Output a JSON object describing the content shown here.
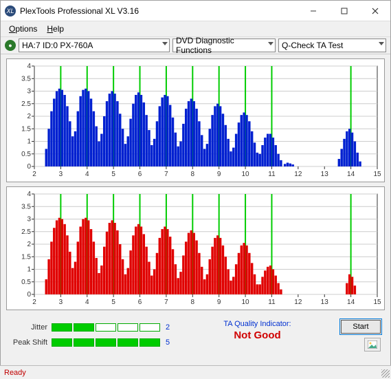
{
  "window": {
    "title": "PlexTools Professional XL V3.16"
  },
  "menu": {
    "options": "Options",
    "help": "Help"
  },
  "toolbar": {
    "drive": "HA:7 ID:0   PX-760A",
    "func": "DVD Diagnostic Functions",
    "test": "Q-Check TA Test"
  },
  "meters": {
    "jitter_label": "Jitter",
    "jitter_filled": 2,
    "jitter_value": "2",
    "peak_label": "Peak Shift",
    "peak_filled": 5,
    "peak_value": "5"
  },
  "quality": {
    "label": "TA Quality Indicator:",
    "value": "Not Good"
  },
  "buttons": {
    "start": "Start"
  },
  "status": "Ready",
  "chart_data": [
    {
      "type": "bar",
      "color": "#0020d0",
      "xlim": [
        2,
        15
      ],
      "ylim": [
        0,
        4
      ],
      "yticks": [
        0,
        0.5,
        1,
        1.5,
        2,
        2.5,
        3,
        3.5,
        4
      ],
      "xticks": [
        2,
        3,
        4,
        5,
        6,
        7,
        8,
        9,
        10,
        11,
        12,
        13,
        14,
        15
      ],
      "markers": [
        3,
        4,
        5,
        6,
        7,
        8,
        9,
        10,
        11,
        14
      ],
      "series": [
        {
          "x": 2.45,
          "y": 0.7
        },
        {
          "x": 2.55,
          "y": 1.5
        },
        {
          "x": 2.65,
          "y": 2.2
        },
        {
          "x": 2.75,
          "y": 2.7
        },
        {
          "x": 2.85,
          "y": 3.0
        },
        {
          "x": 2.95,
          "y": 3.1
        },
        {
          "x": 3.05,
          "y": 3.05
        },
        {
          "x": 3.15,
          "y": 2.85
        },
        {
          "x": 3.25,
          "y": 2.4
        },
        {
          "x": 3.35,
          "y": 1.8
        },
        {
          "x": 3.45,
          "y": 1.2
        },
        {
          "x": 3.55,
          "y": 1.4
        },
        {
          "x": 3.65,
          "y": 2.2
        },
        {
          "x": 3.75,
          "y": 2.8
        },
        {
          "x": 3.85,
          "y": 3.05
        },
        {
          "x": 3.95,
          "y": 3.1
        },
        {
          "x": 4.05,
          "y": 3.0
        },
        {
          "x": 4.15,
          "y": 2.7
        },
        {
          "x": 4.25,
          "y": 2.2
        },
        {
          "x": 4.35,
          "y": 1.6
        },
        {
          "x": 4.45,
          "y": 1.0
        },
        {
          "x": 4.55,
          "y": 1.3
        },
        {
          "x": 4.65,
          "y": 2.0
        },
        {
          "x": 4.75,
          "y": 2.6
        },
        {
          "x": 4.85,
          "y": 2.9
        },
        {
          "x": 4.95,
          "y": 3.0
        },
        {
          "x": 5.05,
          "y": 2.9
        },
        {
          "x": 5.15,
          "y": 2.6
        },
        {
          "x": 5.25,
          "y": 2.1
        },
        {
          "x": 5.35,
          "y": 1.5
        },
        {
          "x": 5.45,
          "y": 0.9
        },
        {
          "x": 5.55,
          "y": 1.2
        },
        {
          "x": 5.65,
          "y": 1.9
        },
        {
          "x": 5.75,
          "y": 2.5
        },
        {
          "x": 5.85,
          "y": 2.85
        },
        {
          "x": 5.95,
          "y": 2.95
        },
        {
          "x": 6.05,
          "y": 2.85
        },
        {
          "x": 6.15,
          "y": 2.55
        },
        {
          "x": 6.25,
          "y": 2.05
        },
        {
          "x": 6.35,
          "y": 1.45
        },
        {
          "x": 6.45,
          "y": 0.85
        },
        {
          "x": 6.55,
          "y": 1.1
        },
        {
          "x": 6.65,
          "y": 1.8
        },
        {
          "x": 6.75,
          "y": 2.4
        },
        {
          "x": 6.85,
          "y": 2.75
        },
        {
          "x": 6.95,
          "y": 2.85
        },
        {
          "x": 7.05,
          "y": 2.8
        },
        {
          "x": 7.15,
          "y": 2.45
        },
        {
          "x": 7.25,
          "y": 1.95
        },
        {
          "x": 7.35,
          "y": 1.35
        },
        {
          "x": 7.45,
          "y": 0.8
        },
        {
          "x": 7.55,
          "y": 1.0
        },
        {
          "x": 7.65,
          "y": 1.7
        },
        {
          "x": 7.75,
          "y": 2.3
        },
        {
          "x": 7.85,
          "y": 2.6
        },
        {
          "x": 7.95,
          "y": 2.7
        },
        {
          "x": 8.05,
          "y": 2.6
        },
        {
          "x": 8.15,
          "y": 2.3
        },
        {
          "x": 8.25,
          "y": 1.8
        },
        {
          "x": 8.35,
          "y": 1.25
        },
        {
          "x": 8.45,
          "y": 0.7
        },
        {
          "x": 8.55,
          "y": 0.9
        },
        {
          "x": 8.65,
          "y": 1.5
        },
        {
          "x": 8.75,
          "y": 2.05
        },
        {
          "x": 8.85,
          "y": 2.4
        },
        {
          "x": 8.95,
          "y": 2.5
        },
        {
          "x": 9.05,
          "y": 2.4
        },
        {
          "x": 9.15,
          "y": 2.1
        },
        {
          "x": 9.25,
          "y": 1.65
        },
        {
          "x": 9.35,
          "y": 1.1
        },
        {
          "x": 9.45,
          "y": 0.6
        },
        {
          "x": 9.55,
          "y": 0.75
        },
        {
          "x": 9.65,
          "y": 1.3
        },
        {
          "x": 9.75,
          "y": 1.75
        },
        {
          "x": 9.85,
          "y": 2.05
        },
        {
          "x": 9.95,
          "y": 2.15
        },
        {
          "x": 10.05,
          "y": 2.05
        },
        {
          "x": 10.15,
          "y": 1.8
        },
        {
          "x": 10.25,
          "y": 1.4
        },
        {
          "x": 10.35,
          "y": 0.95
        },
        {
          "x": 10.45,
          "y": 0.55
        },
        {
          "x": 10.55,
          "y": 0.5
        },
        {
          "x": 10.65,
          "y": 0.85
        },
        {
          "x": 10.75,
          "y": 1.15
        },
        {
          "x": 10.85,
          "y": 1.3
        },
        {
          "x": 10.95,
          "y": 1.3
        },
        {
          "x": 11.05,
          "y": 1.15
        },
        {
          "x": 11.15,
          "y": 0.85
        },
        {
          "x": 11.25,
          "y": 0.5
        },
        {
          "x": 11.35,
          "y": 0.25
        },
        {
          "x": 11.5,
          "y": 0.1
        },
        {
          "x": 11.6,
          "y": 0.15
        },
        {
          "x": 11.7,
          "y": 0.12
        },
        {
          "x": 11.8,
          "y": 0.08
        },
        {
          "x": 13.55,
          "y": 0.3
        },
        {
          "x": 13.65,
          "y": 0.7
        },
        {
          "x": 13.75,
          "y": 1.1
        },
        {
          "x": 13.85,
          "y": 1.4
        },
        {
          "x": 13.95,
          "y": 1.5
        },
        {
          "x": 14.05,
          "y": 1.35
        },
        {
          "x": 14.15,
          "y": 1.0
        },
        {
          "x": 14.25,
          "y": 0.55
        },
        {
          "x": 14.35,
          "y": 0.2
        }
      ]
    },
    {
      "type": "bar",
      "color": "#e00000",
      "xlim": [
        2,
        15
      ],
      "ylim": [
        0,
        4
      ],
      "yticks": [
        0,
        0.5,
        1,
        1.5,
        2,
        2.5,
        3,
        3.5,
        4
      ],
      "xticks": [
        2,
        3,
        4,
        5,
        6,
        7,
        8,
        9,
        10,
        11,
        12,
        13,
        14,
        15
      ],
      "markers": [
        3,
        4,
        5,
        6,
        7,
        8,
        9,
        10,
        11,
        14
      ],
      "series": [
        {
          "x": 2.45,
          "y": 0.6
        },
        {
          "x": 2.55,
          "y": 1.4
        },
        {
          "x": 2.65,
          "y": 2.1
        },
        {
          "x": 2.75,
          "y": 2.65
        },
        {
          "x": 2.85,
          "y": 2.95
        },
        {
          "x": 2.95,
          "y": 3.05
        },
        {
          "x": 3.05,
          "y": 3.0
        },
        {
          "x": 3.15,
          "y": 2.8
        },
        {
          "x": 3.25,
          "y": 2.35
        },
        {
          "x": 3.35,
          "y": 1.7
        },
        {
          "x": 3.45,
          "y": 1.05
        },
        {
          "x": 3.55,
          "y": 1.3
        },
        {
          "x": 3.65,
          "y": 2.1
        },
        {
          "x": 3.75,
          "y": 2.7
        },
        {
          "x": 3.85,
          "y": 3.0
        },
        {
          "x": 3.95,
          "y": 3.05
        },
        {
          "x": 4.05,
          "y": 2.95
        },
        {
          "x": 4.15,
          "y": 2.6
        },
        {
          "x": 4.25,
          "y": 2.1
        },
        {
          "x": 4.35,
          "y": 1.45
        },
        {
          "x": 4.45,
          "y": 0.85
        },
        {
          "x": 4.55,
          "y": 1.15
        },
        {
          "x": 4.65,
          "y": 1.9
        },
        {
          "x": 4.75,
          "y": 2.5
        },
        {
          "x": 4.85,
          "y": 2.85
        },
        {
          "x": 4.95,
          "y": 2.95
        },
        {
          "x": 5.05,
          "y": 2.85
        },
        {
          "x": 5.15,
          "y": 2.55
        },
        {
          "x": 5.25,
          "y": 2.0
        },
        {
          "x": 5.35,
          "y": 1.4
        },
        {
          "x": 5.45,
          "y": 0.8
        },
        {
          "x": 5.55,
          "y": 1.05
        },
        {
          "x": 5.65,
          "y": 1.75
        },
        {
          "x": 5.75,
          "y": 2.35
        },
        {
          "x": 5.85,
          "y": 2.7
        },
        {
          "x": 5.95,
          "y": 2.8
        },
        {
          "x": 6.05,
          "y": 2.7
        },
        {
          "x": 6.15,
          "y": 2.4
        },
        {
          "x": 6.25,
          "y": 1.9
        },
        {
          "x": 6.35,
          "y": 1.3
        },
        {
          "x": 6.45,
          "y": 0.75
        },
        {
          "x": 6.55,
          "y": 1.0
        },
        {
          "x": 6.65,
          "y": 1.65
        },
        {
          "x": 6.75,
          "y": 2.25
        },
        {
          "x": 6.85,
          "y": 2.6
        },
        {
          "x": 6.95,
          "y": 2.7
        },
        {
          "x": 7.05,
          "y": 2.6
        },
        {
          "x": 7.15,
          "y": 2.3
        },
        {
          "x": 7.25,
          "y": 1.8
        },
        {
          "x": 7.35,
          "y": 1.2
        },
        {
          "x": 7.45,
          "y": 0.65
        },
        {
          "x": 7.55,
          "y": 0.9
        },
        {
          "x": 7.65,
          "y": 1.55
        },
        {
          "x": 7.75,
          "y": 2.1
        },
        {
          "x": 7.85,
          "y": 2.45
        },
        {
          "x": 7.95,
          "y": 2.55
        },
        {
          "x": 8.05,
          "y": 2.45
        },
        {
          "x": 8.15,
          "y": 2.15
        },
        {
          "x": 8.25,
          "y": 1.65
        },
        {
          "x": 8.35,
          "y": 1.1
        },
        {
          "x": 8.45,
          "y": 0.6
        },
        {
          "x": 8.55,
          "y": 0.8
        },
        {
          "x": 8.65,
          "y": 1.4
        },
        {
          "x": 8.75,
          "y": 1.9
        },
        {
          "x": 8.85,
          "y": 2.25
        },
        {
          "x": 8.95,
          "y": 2.35
        },
        {
          "x": 9.05,
          "y": 2.25
        },
        {
          "x": 9.15,
          "y": 1.95
        },
        {
          "x": 9.25,
          "y": 1.5
        },
        {
          "x": 9.35,
          "y": 1.0
        },
        {
          "x": 9.45,
          "y": 0.55
        },
        {
          "x": 9.55,
          "y": 0.7
        },
        {
          "x": 9.65,
          "y": 1.2
        },
        {
          "x": 9.75,
          "y": 1.65
        },
        {
          "x": 9.85,
          "y": 1.95
        },
        {
          "x": 9.95,
          "y": 2.05
        },
        {
          "x": 10.05,
          "y": 1.95
        },
        {
          "x": 10.15,
          "y": 1.65
        },
        {
          "x": 10.25,
          "y": 1.25
        },
        {
          "x": 10.35,
          "y": 0.8
        },
        {
          "x": 10.45,
          "y": 0.4
        },
        {
          "x": 10.55,
          "y": 0.4
        },
        {
          "x": 10.65,
          "y": 0.7
        },
        {
          "x": 10.75,
          "y": 0.95
        },
        {
          "x": 10.85,
          "y": 1.1
        },
        {
          "x": 10.95,
          "y": 1.15
        },
        {
          "x": 11.05,
          "y": 1.0
        },
        {
          "x": 11.15,
          "y": 0.75
        },
        {
          "x": 11.25,
          "y": 0.45
        },
        {
          "x": 11.35,
          "y": 0.2
        },
        {
          "x": 13.85,
          "y": 0.45
        },
        {
          "x": 13.95,
          "y": 0.8
        },
        {
          "x": 14.05,
          "y": 0.7
        },
        {
          "x": 14.15,
          "y": 0.35
        }
      ]
    }
  ]
}
